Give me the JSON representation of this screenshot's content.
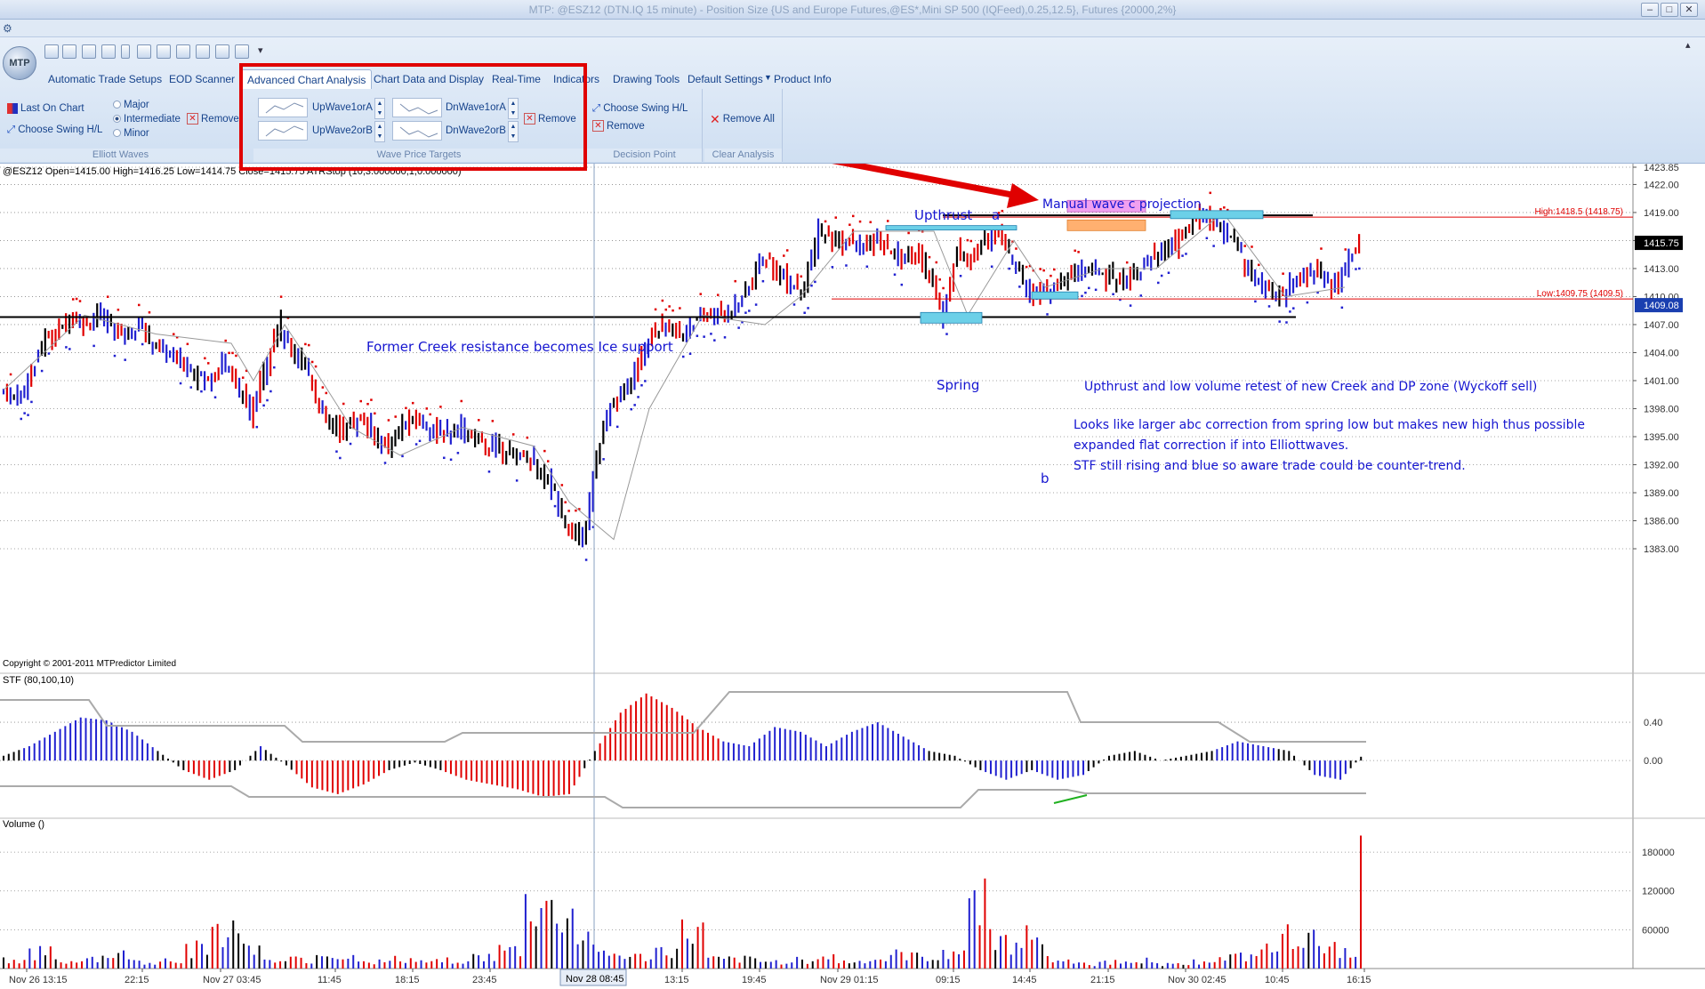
{
  "window": {
    "title": "MTP: @ESZ12 (DTN.IQ 15 minute) - Position Size {US and Europe Futures,@ES*,Mini SP 500 (IQFeed),0.25,12.5}, Futures {20000,2%}",
    "min": "–",
    "max": "□",
    "close": "✕"
  },
  "logo": "MTP",
  "tabs": [
    "Automatic Trade Setups",
    "EOD Scanner",
    "Advanced Chart Analysis",
    "Chart Data and Display",
    "Real-Time",
    "Indicators",
    "Drawing Tools",
    "Default Settings",
    "Product Info"
  ],
  "groups": {
    "elliott": {
      "label": "Elliott Waves",
      "last_on_chart": "Last On Chart",
      "choose_swing": "Choose Swing H/L",
      "major": "Major",
      "intermediate": "Intermediate",
      "minor": "Minor",
      "remove": "Remove"
    },
    "wave_price": {
      "label": "Wave Price Targets",
      "up1": "UpWave1orA",
      "up2": "UpWave2orB",
      "dn1": "DnWave1orA",
      "dn2": "DnWave2orB",
      "remove": "Remove"
    },
    "decision": {
      "label": "Decision Point",
      "choose_swing": "Choose Swing H/L",
      "remove": "Remove"
    },
    "clear": {
      "label": "Clear Analysis",
      "remove_all": "Remove All"
    }
  },
  "colors": {
    "highlight": "#e00000",
    "bull": "#e00000",
    "bear": "#2020d0",
    "neutral": "#000000",
    "annot": "#1515d0"
  },
  "chart_data": [
    {
      "type": "candlestick",
      "title": "@ESZ12  Open=1415.00  High=1416.25  Low=1414.75  Close=1415.75   ATRStop (10,3.000000,1,0.000000)",
      "ylim": [
        1383,
        1423.85
      ],
      "yticks": [
        "1423.85",
        "1422.00",
        "1419.00",
        "1416.00",
        "1413.00",
        "1410.00",
        "1407.00",
        "1404.00",
        "1401.00",
        "1398.00",
        "1395.00",
        "1392.00",
        "1389.00",
        "1386.00",
        "1383.00"
      ],
      "xticks": [
        "Nov 26 13:15",
        "22:15",
        "Nov 27 03:45",
        "11:45",
        "18:15",
        "23:45",
        "Nov 28 08:45",
        "13:15",
        "19:45",
        "Nov 29 01:15",
        "09:15",
        "14:45",
        "21:15",
        "Nov 30 02:45",
        "10:45",
        "16:15"
      ],
      "cursor_xlabel": "Nov 28 08:45",
      "last_price": "1415.75",
      "low_marker": "1409.08",
      "high_line": {
        "label": "High:1418.5 (1418.75)",
        "value": 1418.5
      },
      "low_line": {
        "label": "Low:1409.75 (1409.5)",
        "value": 1409.75
      },
      "close_path": [
        1400,
        1399,
        1401,
        1405,
        1406,
        1408,
        1407,
        1408,
        1407,
        1406,
        1407,
        1405,
        1404,
        1403,
        1402,
        1401,
        1403,
        1401,
        1397,
        1402,
        1407,
        1404,
        1403,
        1398,
        1396,
        1396,
        1397,
        1395,
        1394,
        1396,
        1397,
        1396,
        1395,
        1396,
        1395,
        1394,
        1394,
        1393,
        1393,
        1391,
        1389,
        1385,
        1384,
        1393,
        1398,
        1400,
        1403,
        1406,
        1407,
        1406,
        1407,
        1408,
        1408,
        1409,
        1411,
        1414,
        1413,
        1411,
        1411,
        1417,
        1416,
        1416,
        1415,
        1416,
        1415,
        1414,
        1415,
        1412,
        1408,
        1415,
        1414,
        1416,
        1417,
        1414,
        1411,
        1410,
        1411,
        1412,
        1413,
        1413,
        1412,
        1412,
        1413,
        1414,
        1415,
        1416,
        1418,
        1419,
        1417,
        1416,
        1413,
        1411,
        1410,
        1411,
        1412,
        1413,
        1411,
        1413,
        1416
      ],
      "copyright": "Copyright © 2001-2011 MTPredictor Limited"
    },
    {
      "type": "bar",
      "title": "STF (80,100,10)",
      "ylim": [
        -0.5,
        0.8
      ],
      "yticks": [
        "0.40",
        "0.00"
      ],
      "values": [
        0.05,
        0.15,
        0.3,
        0.45,
        0.42,
        0.3,
        0.1,
        -0.1,
        -0.2,
        -0.1,
        0.15,
        -0.05,
        -0.28,
        -0.35,
        -0.25,
        -0.1,
        -0.02,
        -0.1,
        -0.2,
        -0.25,
        -0.3,
        -0.38,
        -0.35,
        0.1,
        0.5,
        0.7,
        0.55,
        0.35,
        0.2,
        0.15,
        0.35,
        0.3,
        0.15,
        0.3,
        0.4,
        0.25,
        0.1,
        0.05,
        -0.1,
        -0.2,
        -0.1,
        -0.2,
        -0.15,
        0.05,
        0.1,
        0.0,
        0.05,
        0.1,
        0.2,
        0.15,
        0.1,
        -0.15,
        -0.2,
        0.1
      ]
    },
    {
      "type": "bar",
      "title": "Volume ()",
      "ylim": [
        0,
        220000
      ],
      "yticks": [
        "180000",
        "120000",
        "60000"
      ],
      "values": [
        20000,
        35000,
        15000,
        25000,
        30000,
        15000,
        20000,
        45000,
        90000,
        60000,
        15000,
        20000,
        30000,
        25000,
        15000,
        20000,
        15000,
        20000,
        25000,
        40000,
        140000,
        120000,
        70000,
        30000,
        25000,
        40000,
        80000,
        20000,
        20000,
        15000,
        20000,
        25000,
        15000,
        20000,
        30000,
        25000,
        40000,
        150000,
        60000,
        70000,
        20000,
        10000,
        15000,
        20000,
        10000,
        15000,
        20000,
        25000,
        40000,
        70000,
        60000,
        45000,
        210000
      ]
    }
  ],
  "annotations": {
    "upthrust": "Upthrust",
    "a": "a",
    "b": "b",
    "spring": "Spring",
    "manual": "Manual wave c projection",
    "former_creek": "Former Creek resistance becomes Ice support",
    "upthrust_retest": "Upthrust and low volume retest of new Creek and DP zone (Wyckoff sell)",
    "comment1": "Looks like larger abc correction from spring low but makes new high thus possible",
    "comment2": "expanded flat correction if into Elliottwaves.",
    "comment3": "STF still rising and blue so aware trade could be counter-trend."
  }
}
